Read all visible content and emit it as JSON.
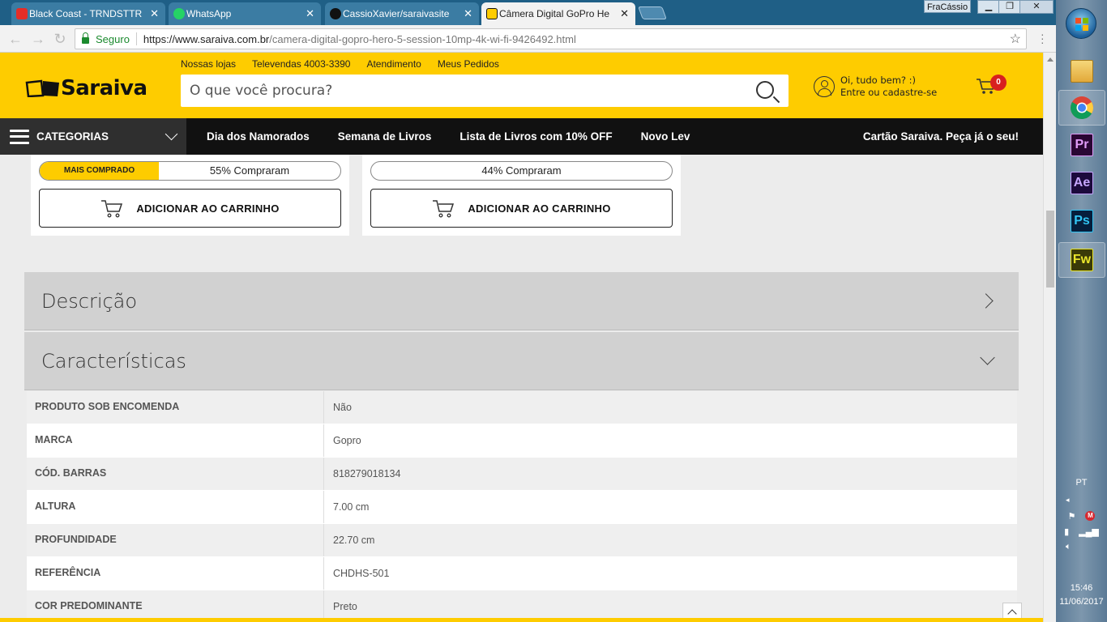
{
  "browser": {
    "tabs": [
      {
        "title": "Black Coast - TRNDSTTR",
        "favicon": "youtube-icon"
      },
      {
        "title": "WhatsApp",
        "favicon": "whatsapp-icon"
      },
      {
        "title": "CassioXavier/saraivasite",
        "favicon": "github-icon"
      },
      {
        "title": "Câmera Digital GoPro He",
        "favicon": "saraiva-icon",
        "active": true
      }
    ],
    "profile_name": "FraCássio",
    "secure_label": "Seguro",
    "url_domain": "https://www.saraiva.com.br",
    "url_path": "/camera-digital-gopro-hero-5-session-10mp-4k-wi-fi-9426492.html"
  },
  "header": {
    "logo_text": "Saraiva",
    "top_links": [
      "Nossas lojas",
      "Televendas 4003-3390",
      "Atendimento",
      "Meus Pedidos"
    ],
    "search_placeholder": "O que você procura?",
    "account_greeting": "Oi, tudo bem? :)",
    "account_action": "Entre ou cadastre-se",
    "cart_count": "0"
  },
  "navbar": {
    "categories_label": "CATEGORIAS",
    "links": [
      "Dia dos Namorados",
      "Semana de Livros",
      "Lista de Livros com 10% OFF",
      "Novo Lev"
    ],
    "promo": "Cartão Saraiva. Peça já o seu!"
  },
  "offers": [
    {
      "badge": "MAIS COMPRADO",
      "bought_label": "55% Compraram",
      "bought_fraction": 0.55,
      "button": "ADICIONAR AO CARRINHO"
    },
    {
      "badge": "",
      "bought_label": "44% Compraram",
      "bought_fraction": 0.44,
      "button": "ADICIONAR AO CARRINHO"
    }
  ],
  "sections": {
    "description_title": "Descrição",
    "characteristics_title": "Características"
  },
  "specs": [
    {
      "key": "PRODUTO SOB ENCOMENDA",
      "value": "Não"
    },
    {
      "key": "MARCA",
      "value": "Gopro"
    },
    {
      "key": "CÓD. BARRAS",
      "value": "818279018134"
    },
    {
      "key": "ALTURA",
      "value": "7.00 cm"
    },
    {
      "key": "PROFUNDIDADE",
      "value": "22.70 cm"
    },
    {
      "key": "REFERÊNCIA",
      "value": "CHDHS-501"
    },
    {
      "key": "COR PREDOMINANTE",
      "value": "Preto"
    }
  ],
  "taskbar": {
    "apps": [
      {
        "name": "file-explorer-icon",
        "label": ""
      },
      {
        "name": "chrome-icon",
        "label": ""
      },
      {
        "name": "premiere-icon",
        "label": "Pr"
      },
      {
        "name": "after-effects-icon",
        "label": "Ae"
      },
      {
        "name": "photoshop-icon",
        "label": "Ps"
      },
      {
        "name": "fireworks-icon",
        "label": "Fw"
      }
    ],
    "language": "PT",
    "time": "15:46",
    "date": "11/06/2017"
  },
  "colors": {
    "brand_yellow": "#fecc00",
    "nav_dark": "#111111"
  }
}
